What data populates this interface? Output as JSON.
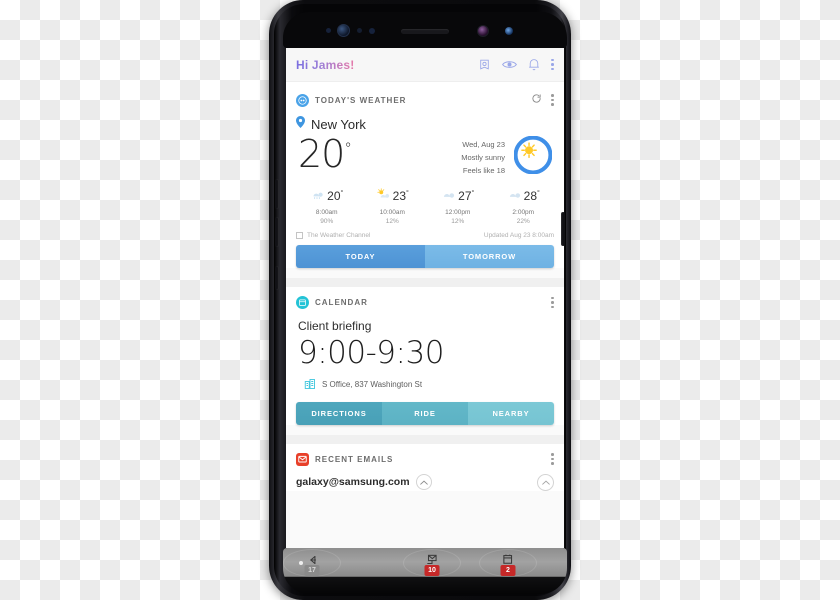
{
  "header": {
    "greeting": "Hi James!",
    "icons": [
      "bixby-icon",
      "eye-icon",
      "bell-icon",
      "overflow-menu-icon"
    ]
  },
  "weather_card": {
    "category": "TODAY'S WEATHER",
    "category_icon": "weather-badge-icon",
    "refresh_icon": "refresh-icon",
    "menu_icon": "overflow-menu-icon",
    "location_icon": "location-pin-icon",
    "location": "New York",
    "current_temp": "20",
    "degree": "°",
    "date": "Wed, Aug 23",
    "condition": "Mostly sunny",
    "feels_like": "Feels like 18",
    "condition_icon": "sun-behind-cloud-icon",
    "hourly": [
      {
        "icon": "rain-cloud-icon",
        "temp": "20",
        "time": "8:00am",
        "precip": "90%"
      },
      {
        "icon": "sun-cloud-icon",
        "temp": "23",
        "time": "10:00am",
        "precip": "12%"
      },
      {
        "icon": "cloud-icon",
        "temp": "27",
        "time": "12:00pm",
        "precip": "12%"
      },
      {
        "icon": "cloud-icon",
        "temp": "28",
        "time": "2:00pm",
        "precip": "22%"
      }
    ],
    "source": "The Weather Channel",
    "source_icon": "weather-channel-icon",
    "updated": "Updated Aug 23  8:00am",
    "tabs": [
      {
        "label": "TODAY",
        "active": true
      },
      {
        "label": "TOMORROW",
        "active": false
      }
    ]
  },
  "calendar_card": {
    "category": "CALENDAR",
    "category_icon": "calendar-badge-icon",
    "menu_icon": "overflow-menu-icon",
    "event_title": "Client briefing",
    "event_time": "9:00-9:30",
    "location_icon": "office-building-icon",
    "event_location": "S Office, 837 Washington St",
    "actions": [
      {
        "label": "DIRECTIONS"
      },
      {
        "label": "RIDE"
      },
      {
        "label": "NEARBY"
      }
    ]
  },
  "email_card": {
    "category": "RECENT EMAILS",
    "category_icon": "email-badge-icon",
    "menu_icon": "overflow-menu-icon",
    "address": "galaxy@samsung.com",
    "expand_icon": "chevron-up-icon",
    "scroll_icon": "chevron-up-icon"
  },
  "navbar": {
    "items": [
      {
        "icon": "email-nav-icon",
        "badge": "10"
      },
      {
        "icon": "calendar-nav-icon",
        "badge": "2"
      },
      {
        "icon": "back-nav-icon",
        "badge": "17"
      }
    ]
  },
  "colors": {
    "weather_accent": "#4aa3e8",
    "calendar_accent": "#23c3d6",
    "email_accent": "#e8402a",
    "badge_red": "#c62828"
  }
}
